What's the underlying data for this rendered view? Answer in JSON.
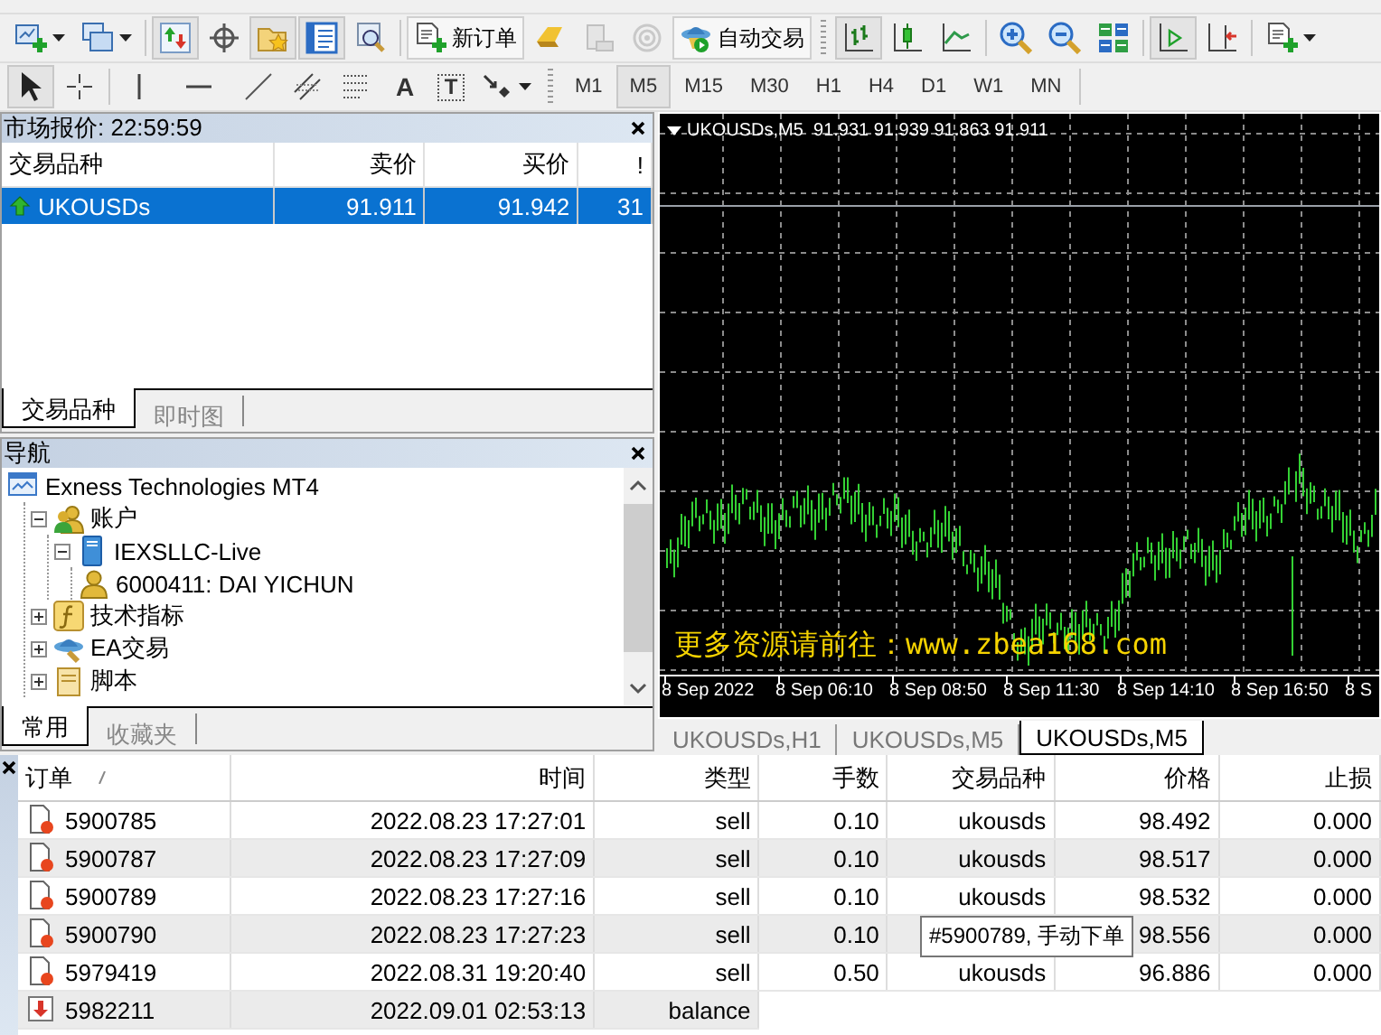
{
  "toolbar_main": [
    {
      "kind": "new-chart",
      "pressed": false,
      "disabled": false,
      "menu": true
    },
    {
      "kind": "profiles",
      "pressed": false,
      "disabled": false,
      "menu": true
    },
    {
      "kind": "separator"
    },
    {
      "kind": "market-watch",
      "pressed": true,
      "disabled": false,
      "menu": false
    },
    {
      "kind": "data-window",
      "pressed": false,
      "disabled": false,
      "menu": false
    },
    {
      "kind": "navigator",
      "pressed": true,
      "disabled": false,
      "menu": false
    },
    {
      "kind": "terminal",
      "pressed": true,
      "disabled": false,
      "menu": false
    },
    {
      "kind": "tester",
      "pressed": false,
      "disabled": false,
      "menu": false
    },
    {
      "kind": "separator"
    },
    {
      "kind": "new-order",
      "label": "新订单",
      "pressed": false,
      "disabled": false,
      "menu": false
    },
    {
      "kind": "history",
      "pressed": false,
      "disabled": false,
      "menu": false
    },
    {
      "kind": "server",
      "pressed": false,
      "disabled": true,
      "menu": false
    },
    {
      "kind": "signals",
      "pressed": false,
      "disabled": true,
      "menu": false
    },
    {
      "kind": "auto-trading",
      "label": "自动交易",
      "pressed": false,
      "disabled": false,
      "menu": false
    },
    {
      "kind": "grip"
    },
    {
      "kind": "bar-chart",
      "pressed": true,
      "disabled": false,
      "menu": false
    },
    {
      "kind": "candles",
      "pressed": false,
      "disabled": false,
      "menu": false
    },
    {
      "kind": "line-chart",
      "pressed": false,
      "disabled": false,
      "menu": false
    },
    {
      "kind": "separator"
    },
    {
      "kind": "zoom-in",
      "pressed": false,
      "disabled": false,
      "menu": false
    },
    {
      "kind": "zoom-out",
      "pressed": false,
      "disabled": false,
      "menu": false
    },
    {
      "kind": "tile",
      "pressed": false,
      "disabled": false,
      "menu": false
    },
    {
      "kind": "separator"
    },
    {
      "kind": "autoscroll",
      "pressed": true,
      "disabled": false,
      "menu": false
    },
    {
      "kind": "chart-shift",
      "pressed": false,
      "disabled": false,
      "menu": false
    },
    {
      "kind": "separator"
    },
    {
      "kind": "indicators",
      "pressed": false,
      "disabled": false,
      "menu": true
    }
  ],
  "toolbar_draw": [
    {
      "kind": "pointer",
      "pressed": true,
      "menu": false
    },
    {
      "kind": "crosshair",
      "pressed": false,
      "menu": false
    },
    {
      "kind": "separator"
    },
    {
      "kind": "vline",
      "pressed": false,
      "menu": false
    },
    {
      "kind": "hline",
      "pressed": false,
      "menu": false
    },
    {
      "kind": "trendline",
      "pressed": false,
      "menu": false
    },
    {
      "kind": "channel",
      "pressed": false,
      "menu": false
    },
    {
      "kind": "fibo",
      "pressed": false,
      "menu": false
    },
    {
      "kind": "text",
      "glyph": "A",
      "pressed": false,
      "menu": false
    },
    {
      "kind": "label",
      "glyph": "T",
      "pressed": false,
      "menu": false
    },
    {
      "kind": "arrows",
      "pressed": false,
      "menu": true
    },
    {
      "kind": "grip"
    }
  ],
  "timeframes": [
    {
      "label": "M1",
      "selected": false
    },
    {
      "label": "M5",
      "selected": true
    },
    {
      "label": "M15",
      "selected": false
    },
    {
      "label": "M30",
      "selected": false
    },
    {
      "label": "H1",
      "selected": false
    },
    {
      "label": "H4",
      "selected": false
    },
    {
      "label": "D1",
      "selected": false
    },
    {
      "label": "W1",
      "selected": false
    },
    {
      "label": "MN",
      "selected": false
    }
  ],
  "market_watch": {
    "title": "市场报价: 22:59:59",
    "columns": [
      "交易品种",
      "卖价",
      "买价",
      "!"
    ],
    "rows": [
      {
        "symbol": "UKOUSDs",
        "bid": "91.911",
        "ask": "91.942",
        "spread": "31",
        "selected": true
      }
    ],
    "tabs": [
      {
        "label": "交易品种",
        "selected": true
      },
      {
        "label": "即时图",
        "selected": false
      }
    ]
  },
  "navigator": {
    "title": "导航",
    "tree": [
      {
        "label": "Exness Technologies MT4",
        "kind": "terminal",
        "children": [
          {
            "label": "账户",
            "kind": "accounts",
            "expanded": true,
            "children": [
              {
                "label": "IEXSLLC-Live",
                "kind": "server",
                "expanded": true,
                "children": [
                  {
                    "label": "6000411: DAI YICHUN",
                    "kind": "account"
                  }
                ]
              }
            ]
          },
          {
            "label": "技术指标",
            "kind": "indicators",
            "expanded": false
          },
          {
            "label": "EA交易",
            "kind": "experts",
            "expanded": false
          },
          {
            "label": "脚本",
            "kind": "scripts",
            "expanded": false
          }
        ]
      }
    ],
    "tabs": [
      {
        "label": "常用",
        "selected": true
      },
      {
        "label": "收藏夹",
        "selected": false
      }
    ]
  },
  "chart": {
    "legend": "UKOUSDs,M5  91.931 91.939 91.863 91.911",
    "overlay_text": "更多资源请前往：www.zbea168.com",
    "time_labels": [
      "8 Sep 2022",
      "8 Sep 06:10",
      "8 Sep 08:50",
      "8 Sep 11:30",
      "8 Sep 14:10",
      "8 Sep 16:50",
      "8 S"
    ]
  },
  "chart_tabs": [
    {
      "label": "UKOUSDs,H1",
      "selected": false
    },
    {
      "label": "UKOUSDs,M5",
      "selected": false
    },
    {
      "label": "UKOUSDs,M5",
      "selected": true
    }
  ],
  "terminal": {
    "columns": [
      "订单",
      "时间",
      "类型",
      "手数",
      "交易品种",
      "价格",
      "止损"
    ],
    "rows": [
      {
        "kind": "order",
        "order": "5900785",
        "time": "2022.08.23 17:27:01",
        "type": "sell",
        "lots": "0.10",
        "symbol": "ukousds",
        "price": "98.492",
        "sl": "0.000"
      },
      {
        "kind": "order",
        "order": "5900787",
        "time": "2022.08.23 17:27:09",
        "type": "sell",
        "lots": "0.10",
        "symbol": "ukousds",
        "price": "98.517",
        "sl": "0.000"
      },
      {
        "kind": "order",
        "order": "5900789",
        "time": "2022.08.23 17:27:16",
        "type": "sell",
        "lots": "0.10",
        "symbol": "ukousds",
        "price": "98.532",
        "sl": "0.000"
      },
      {
        "kind": "order",
        "order": "5900790",
        "time": "2022.08.23 17:27:23",
        "type": "sell",
        "lots": "0.10",
        "price": "98.556",
        "sl": "0.000"
      },
      {
        "kind": "order",
        "order": "5979419",
        "time": "2022.08.31 19:20:40",
        "type": "sell",
        "lots": "0.50",
        "symbol": "ukousds",
        "price": "96.886",
        "sl": "0.000"
      },
      {
        "kind": "balance",
        "order": "5982211",
        "time": "2022.09.01 02:53:13",
        "type": "balance"
      }
    ],
    "tooltip": "#5900789, 手动下单"
  }
}
